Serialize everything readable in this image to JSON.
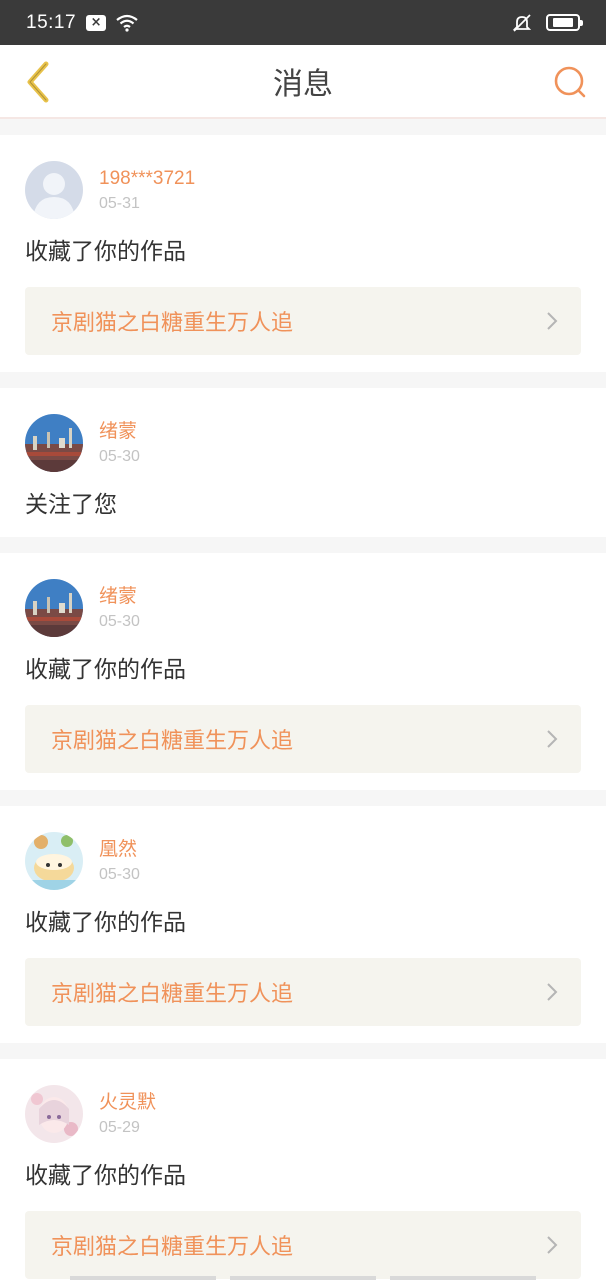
{
  "status_bar": {
    "time": "15:17",
    "badge": "×",
    "icons": [
      "close-badge-icon",
      "wifi-icon",
      "mute-bell-icon",
      "battery-icon"
    ],
    "battery_level": 0.75
  },
  "nav": {
    "title": "消息",
    "back_icon": "back-chevron-icon",
    "search_icon": "search-icon",
    "accent_color": "#f0925a",
    "back_color": "#e8c24a"
  },
  "messages": [
    {
      "username": "198***3721",
      "date": "05-31",
      "action": "收藏了你的作品",
      "work_title": "京剧猫之白糖重生万人追",
      "avatar": "default-avatar-icon"
    },
    {
      "username": "绪蒙",
      "date": "05-30",
      "action": "关注了您",
      "avatar": "city-avatar"
    },
    {
      "username": "绪蒙",
      "date": "05-30",
      "action": "收藏了你的作品",
      "work_title": "京剧猫之白糖重生万人追",
      "avatar": "city-avatar"
    },
    {
      "username": "凰然",
      "date": "05-30",
      "action": "收藏了你的作品",
      "work_title": "京剧猫之白糖重生万人追",
      "avatar": "cake-avatar"
    },
    {
      "username": "火灵默",
      "date": "05-29",
      "action": "收藏了你的作品",
      "work_title": "京剧猫之白糖重生万人追",
      "avatar": "anime-girl-avatar"
    }
  ]
}
